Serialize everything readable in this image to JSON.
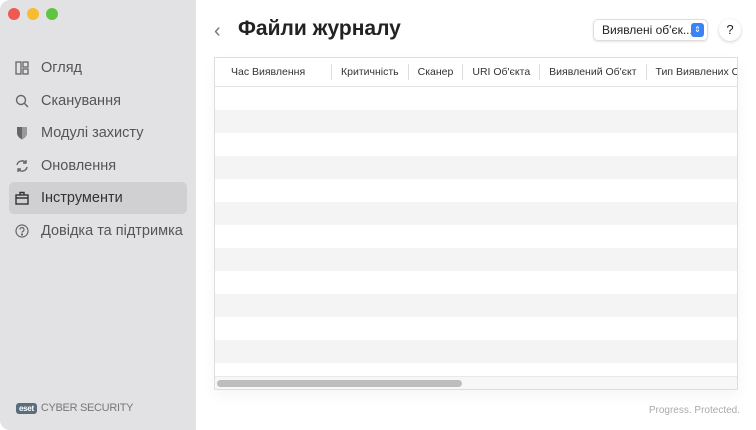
{
  "window": {
    "controls": [
      "close",
      "minimize",
      "zoom"
    ],
    "colors": {
      "close": "#ee5a52",
      "minimize": "#f5bd2f",
      "zoom": "#5fc43f"
    }
  },
  "sidebar": {
    "items": [
      {
        "label": "Огляд",
        "icon": "dashboard-icon"
      },
      {
        "label": "Сканування",
        "icon": "search-icon"
      },
      {
        "label": "Модулі захисту",
        "icon": "shield-icon"
      },
      {
        "label": "Оновлення",
        "icon": "refresh-icon"
      },
      {
        "label": "Інструменти",
        "icon": "toolbox-icon",
        "active": true
      },
      {
        "label": "Довідка та підтримка",
        "icon": "help-circle-icon"
      }
    ],
    "brand": {
      "logo": "eset",
      "product": "CYBER SECURITY"
    }
  },
  "header": {
    "title": "Файли журналу",
    "select_value": "Виявлені об'єк...",
    "help": "?"
  },
  "table": {
    "columns": [
      "Час Виявлення",
      "Критичність",
      "Сканер",
      "URI Об'єкта",
      "Виявлений Об'єкт",
      "Тип Виявлених Об'єктів"
    ],
    "rows": []
  },
  "footer": {
    "tagline": "Progress. Protected."
  }
}
